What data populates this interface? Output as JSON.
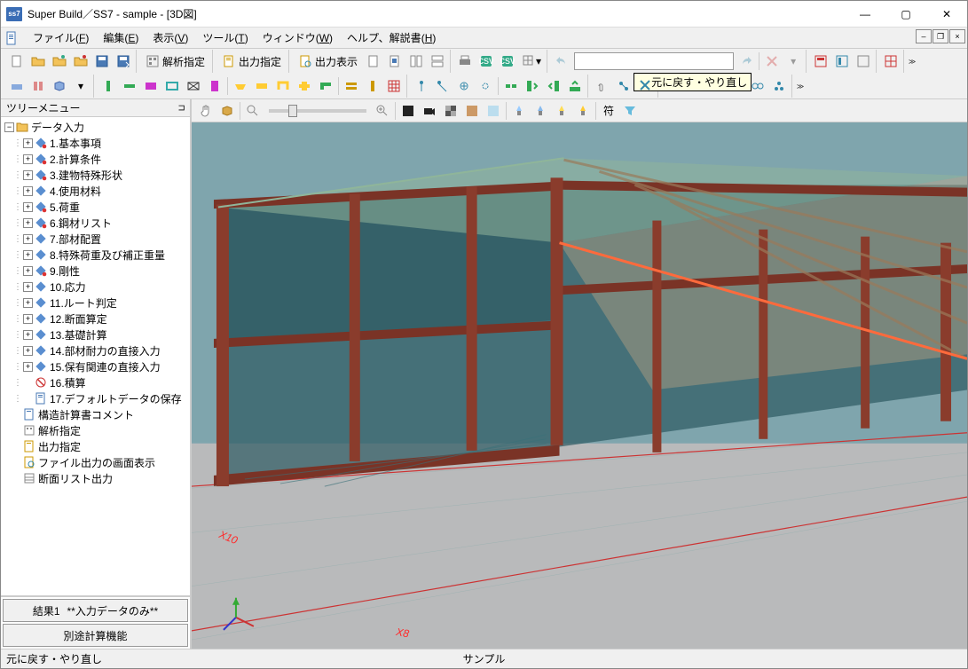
{
  "window": {
    "title": "Super Build／SS7 - sample - [3D図]",
    "app_icon_text": "ss7"
  },
  "menu": {
    "items": [
      "ファイル(F)",
      "編集(E)",
      "表示(V)",
      "ツール(T)",
      "ウィンドウ(W)",
      "ヘルプ、解説書(H)"
    ]
  },
  "toolbar_row1": {
    "btn_analysis_spec": "解析指定",
    "btn_output_spec": "出力指定",
    "btn_output_display": "出力表示"
  },
  "tooltip": {
    "text": "元に戻す・やり直し"
  },
  "tree": {
    "header": "ツリーメニュー",
    "root": "データ入力",
    "items": [
      "1.基本事項",
      "2.計算条件",
      "3.建物特殊形状",
      "4.使用材料",
      "5.荷重",
      "6.鋼材リスト",
      "7.部材配置",
      "8.特殊荷重及び補正重量",
      "9.剛性",
      "10.応力",
      "11.ルート判定",
      "12.断面算定",
      "13.基礎計算",
      "14.部材耐力の直接入力",
      "15.保有関連の直接入力",
      "16.積算",
      "17.デフォルトデータの保存"
    ],
    "extra": [
      "構造計算書コメント",
      "解析指定",
      "出力指定",
      "ファイル出力の画面表示",
      "断面リスト出力"
    ],
    "footer1_a": "結果1",
    "footer1_b": "**入力データのみ**",
    "footer2": "別途計算機能"
  },
  "view_toolbar": {
    "symbol_btn": "符"
  },
  "canvas_labels": {
    "x10": "X10",
    "x8": "X8"
  },
  "status": {
    "left": "元に戻す・やり直し",
    "center": "サンプル"
  }
}
